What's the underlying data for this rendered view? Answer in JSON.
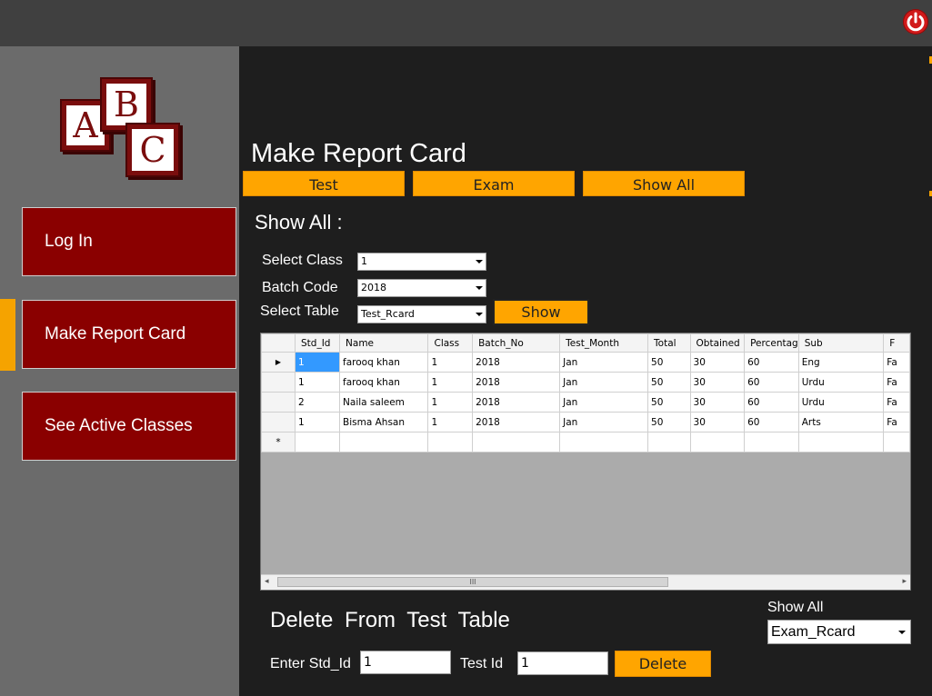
{
  "logo": {
    "letters": [
      "A",
      "B",
      "C"
    ]
  },
  "nav": {
    "items": [
      {
        "label": "Log In"
      },
      {
        "label": "Make Report Card"
      },
      {
        "label": "See Active Classes"
      }
    ]
  },
  "main": {
    "title": "Make Report Card",
    "tabs": [
      "Test",
      "Exam",
      "Show All"
    ],
    "section_title": "Show All :"
  },
  "filters": {
    "class_label": "Select Class",
    "class_value": "1",
    "batch_label": "Batch Code",
    "batch_value": "2018",
    "table_label": "Select Table",
    "table_value": "Test_Rcard",
    "show_button": "Show"
  },
  "grid": {
    "columns": [
      "Std_Id",
      "Name",
      "Class",
      "Batch_No",
      "Test_Month",
      "Total",
      "Obtained",
      "Percentag",
      "Sub",
      "F"
    ],
    "rows": [
      [
        "1",
        "farooq khan",
        "1",
        "2018",
        "Jan",
        "50",
        "30",
        "60",
        "Eng",
        "Fa"
      ],
      [
        "1",
        "farooq khan",
        "1",
        "2018",
        "Jan",
        "50",
        "30",
        "60",
        "Urdu",
        "Fa"
      ],
      [
        "2",
        "Naila saleem",
        "1",
        "2018",
        "Jan",
        "50",
        "30",
        "60",
        "Urdu",
        "Fa"
      ],
      [
        "1",
        "Bisma Ahsan",
        "1",
        "2018",
        "Jan",
        "50",
        "30",
        "60",
        "Arts",
        "Fa"
      ]
    ],
    "new_row_marker": "*",
    "current_row_marker": "▶",
    "scroll_thumb_label": "III",
    "scroll_left": "◂",
    "scroll_right": "▸"
  },
  "delete_section": {
    "title": "Delete  From  Test Table",
    "std_label": "Enter Std_Id",
    "std_value": "1",
    "test_label": "Test Id",
    "test_value": "1",
    "delete_button": "Delete"
  },
  "show_all2": {
    "label": "Show All",
    "value": "Exam_Rcard"
  },
  "icons": {
    "power": "power-icon"
  },
  "colors": {
    "accent": "#ffa500",
    "nav_bg": "#8a0000",
    "sidebar": "#6b6b6b"
  }
}
